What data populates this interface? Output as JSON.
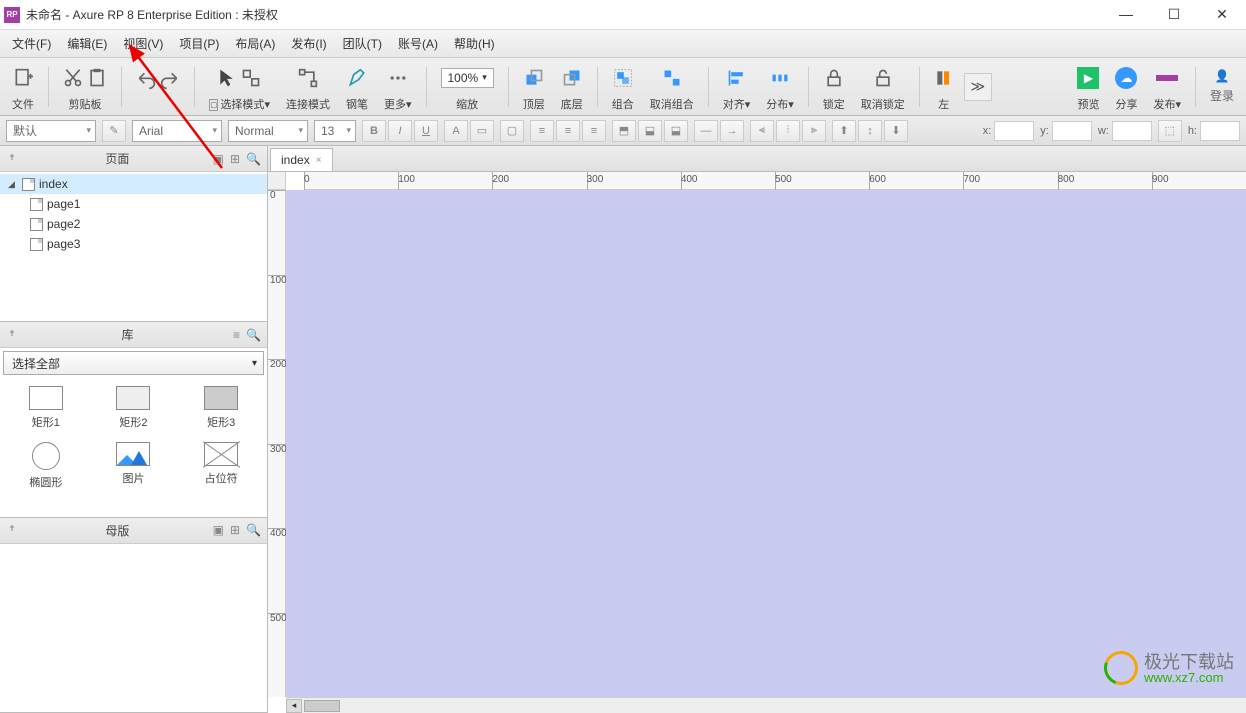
{
  "titlebar": {
    "title": "未命名 - Axure RP 8 Enterprise Edition : 未授权"
  },
  "menu": {
    "file": "文件(F)",
    "edit": "编辑(E)",
    "view": "视图(V)",
    "project": "项目(P)",
    "layout": "布局(A)",
    "publish": "发布(I)",
    "team": "团队(T)",
    "account": "账号(A)",
    "help": "帮助(H)"
  },
  "toolbar": {
    "file": "文件",
    "clipboard": "剪贴板",
    "selectMode": "选择模式",
    "connectMode": "连接模式",
    "pen": "钢笔",
    "more": "更多",
    "zoom": "缩放",
    "zoomValue": "100%",
    "front": "顶层",
    "back": "底层",
    "group": "组合",
    "ungroup": "取消组合",
    "align": "对齐",
    "distribute": "分布",
    "lock": "锁定",
    "unlock": "取消锁定",
    "left": "左",
    "preview": "预览",
    "share": "分享",
    "publishBtn": "发布",
    "login": "登录"
  },
  "format": {
    "style": "默认",
    "font": "Arial",
    "weight": "Normal",
    "size": "13",
    "xLabel": "x:",
    "yLabel": "y:",
    "wLabel": "w:",
    "hLabel": "h:"
  },
  "panels": {
    "pages": "页面",
    "library": "库",
    "masters": "母版",
    "libSelect": "选择全部"
  },
  "pages": {
    "root": "index",
    "children": [
      "page1",
      "page2",
      "page3"
    ]
  },
  "library": {
    "rect1": "矩形1",
    "rect2": "矩形2",
    "rect3": "矩形3",
    "ellipse": "椭圆形",
    "image": "图片",
    "placeholder": "占位符"
  },
  "tabs": {
    "active": "index"
  },
  "ruler": {
    "h": [
      "0",
      "100",
      "200",
      "300",
      "400",
      "500",
      "600",
      "700",
      "800",
      "900"
    ],
    "v": [
      "0",
      "100",
      "200",
      "300",
      "400",
      "500"
    ]
  },
  "watermark": {
    "line1": "极光下载站",
    "line2": "www.xz7.com"
  }
}
